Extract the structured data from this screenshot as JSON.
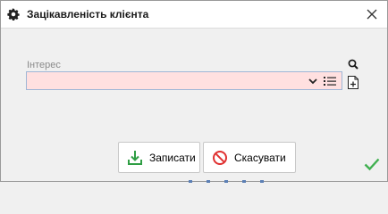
{
  "window": {
    "title": "Зацікавленість клієнта",
    "title_icon": "gear-icon",
    "close_icon": "close-icon"
  },
  "form": {
    "interest": {
      "label": "Інтерес",
      "value": "",
      "highlight_color": "#ffe0e0"
    }
  },
  "buttons": {
    "save_label": "Записати",
    "cancel_label": "Скасувати"
  },
  "colors": {
    "save_icon": "#2f9e44",
    "cancel_icon": "#e03131",
    "ok_check": "#40b050"
  }
}
